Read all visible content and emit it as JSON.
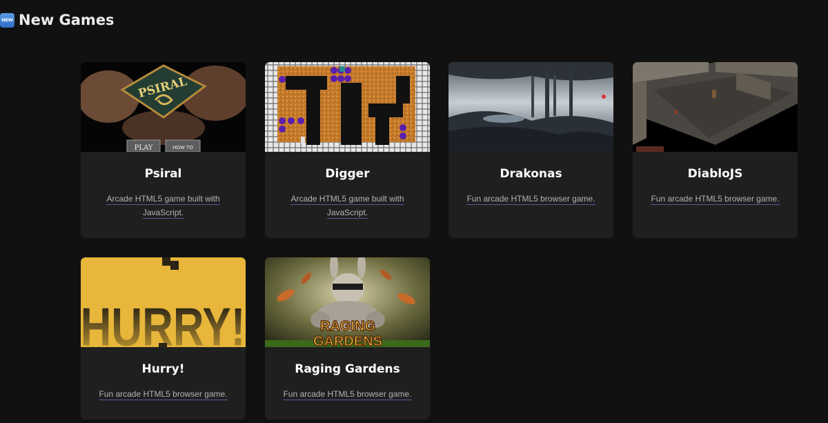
{
  "section": {
    "badge": "NEW",
    "title": "New Games"
  },
  "games": [
    {
      "title": "Psiral",
      "description": "Arcade HTML5 game built with JavaScript.",
      "thumb_logo": "PSIRAL",
      "thumb_buttons": [
        "PLAY",
        "HOW TO"
      ]
    },
    {
      "title": "Digger",
      "description": "Arcade HTML5 game built with JavaScript."
    },
    {
      "title": "Drakonas",
      "description": "Fun arcade HTML5 browser game."
    },
    {
      "title": "DiabloJS",
      "description": "Fun arcade HTML5 browser game."
    },
    {
      "title": "Hurry!",
      "description": "Fun arcade HTML5 browser game.",
      "thumb_logo": "HURRY!"
    },
    {
      "title": "Raging Gardens",
      "description": "Fun arcade HTML5 browser game.",
      "thumb_logo": [
        "RAGING",
        "GARDENS"
      ]
    }
  ]
}
